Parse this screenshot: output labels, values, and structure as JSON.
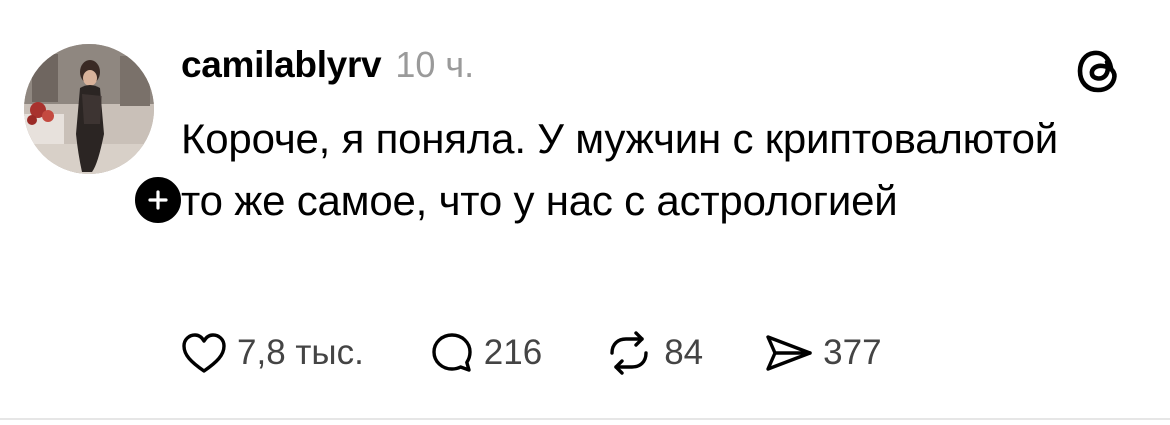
{
  "post": {
    "username": "camilablyrv",
    "timestamp": "10 ч.",
    "text": "Короче, я поняла. У мужчин с криптовалютой то же самое, что у нас с астрологией"
  },
  "actions": {
    "likes": "7,8 тыс.",
    "replies": "216",
    "reposts": "84",
    "shares": "377"
  },
  "icons": {
    "like": "heart-icon",
    "reply": "comment-icon",
    "repost": "repost-icon",
    "share": "send-icon",
    "follow": "plus-icon",
    "app": "threads-logo-icon"
  },
  "colors": {
    "text": "#000000",
    "muted": "#9a9a9a",
    "action_text": "#444444",
    "divider": "#e6e6e6"
  }
}
